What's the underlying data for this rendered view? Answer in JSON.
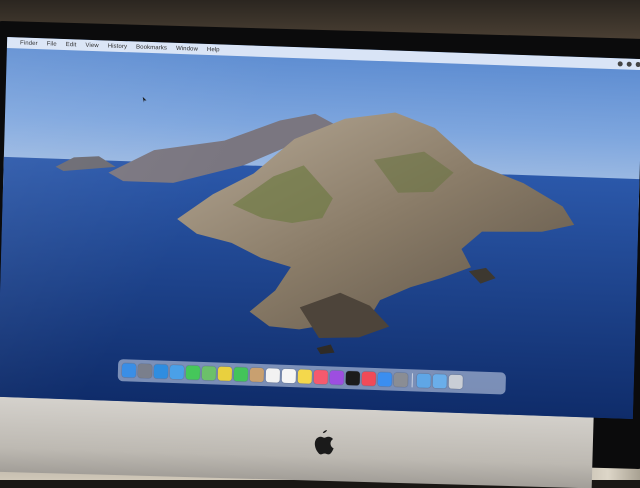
{
  "menubar": {
    "apple_glyph": "",
    "items": [
      "Finder",
      "File",
      "Edit",
      "View",
      "History",
      "Bookmarks",
      "Window",
      "Help"
    ]
  },
  "desktop": {
    "wallpaper": "macOS Catalina island",
    "sky_color": "#7ea6de",
    "sea_color": "#1e428e"
  },
  "dock": {
    "icons": [
      {
        "name": "finder-icon",
        "color": "#3a8ee6"
      },
      {
        "name": "launchpad-icon",
        "color": "#7a7f8c"
      },
      {
        "name": "safari-icon",
        "color": "#2f8de0"
      },
      {
        "name": "mail-icon",
        "color": "#4aa0e8"
      },
      {
        "name": "messages-icon",
        "color": "#45c75a"
      },
      {
        "name": "maps-icon",
        "color": "#6cc06a"
      },
      {
        "name": "photos-icon",
        "color": "#e9d03e"
      },
      {
        "name": "facetime-icon",
        "color": "#43c45a"
      },
      {
        "name": "contacts-icon",
        "color": "#c8a070"
      },
      {
        "name": "calendar-icon",
        "color": "#f2f2f2"
      },
      {
        "name": "reminders-icon",
        "color": "#f5f5f5"
      },
      {
        "name": "notes-icon",
        "color": "#f4d84c"
      },
      {
        "name": "music-icon",
        "color": "#f55a6e"
      },
      {
        "name": "podcasts-icon",
        "color": "#9d4ee0"
      },
      {
        "name": "tv-icon",
        "color": "#1b1b1b"
      },
      {
        "name": "news-icon",
        "color": "#f04a58"
      },
      {
        "name": "app-store-icon",
        "color": "#3b8ef0"
      },
      {
        "name": "system-preferences-icon",
        "color": "#8a8d94"
      },
      {
        "name": "downloads-folder-icon",
        "color": "#5fa6e6"
      },
      {
        "name": "documents-folder-icon",
        "color": "#6aaeea"
      },
      {
        "name": "trash-icon",
        "color": "#c9ced6"
      }
    ]
  },
  "hardware": {
    "chin_logo": "apple-logo"
  }
}
